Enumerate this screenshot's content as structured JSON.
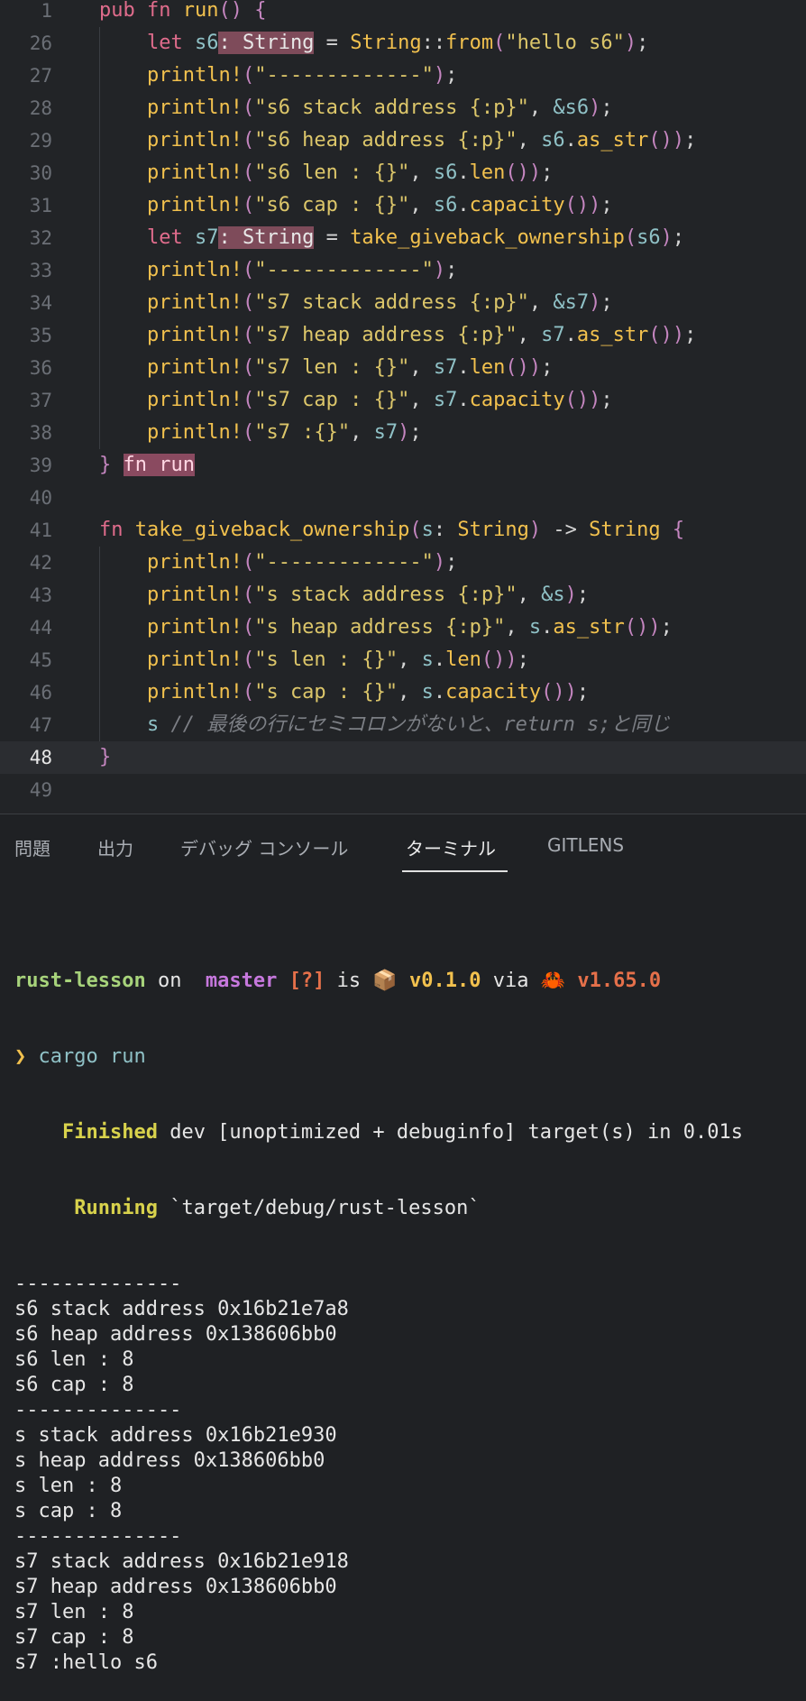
{
  "editor": {
    "lines": [
      {
        "n": "1",
        "tokens": [
          [
            "kw",
            "pub "
          ],
          [
            "kw",
            "fn "
          ],
          [
            "fn",
            "run"
          ],
          [
            "paren",
            "() "
          ],
          [
            "paren",
            "{"
          ]
        ]
      },
      {
        "n": "26",
        "tokens": [
          [
            "sp",
            "    "
          ],
          [
            "kw",
            "let "
          ],
          [
            "var",
            "s6"
          ],
          [
            "hl",
            ": String"
          ],
          [
            "punc",
            " = "
          ],
          [
            "typ",
            "String"
          ],
          [
            "punc",
            "::"
          ],
          [
            "fn",
            "from"
          ],
          [
            "paren",
            "("
          ],
          [
            "str",
            "\"hello s6\""
          ],
          [
            "paren",
            ")"
          ],
          [
            "punc",
            ";"
          ]
        ]
      },
      {
        "n": "27",
        "tokens": [
          [
            "sp",
            "    "
          ],
          [
            "mac",
            "println!"
          ],
          [
            "paren",
            "("
          ],
          [
            "str",
            "\"-------------\""
          ],
          [
            "paren",
            ")"
          ],
          [
            "punc",
            ";"
          ]
        ]
      },
      {
        "n": "28",
        "tokens": [
          [
            "sp",
            "    "
          ],
          [
            "mac",
            "println!"
          ],
          [
            "paren",
            "("
          ],
          [
            "str",
            "\"s6 stack address {:p}\""
          ],
          [
            "punc",
            ", "
          ],
          [
            "var",
            "&s6"
          ],
          [
            "paren",
            ")"
          ],
          [
            "punc",
            ";"
          ]
        ]
      },
      {
        "n": "29",
        "tokens": [
          [
            "sp",
            "    "
          ],
          [
            "mac",
            "println!"
          ],
          [
            "paren",
            "("
          ],
          [
            "str",
            "\"s6 heap address {:p}\""
          ],
          [
            "punc",
            ", "
          ],
          [
            "var",
            "s6"
          ],
          [
            "punc",
            "."
          ],
          [
            "fn",
            "as_str"
          ],
          [
            "paren",
            "())"
          ],
          [
            "punc",
            ";"
          ]
        ]
      },
      {
        "n": "30",
        "tokens": [
          [
            "sp",
            "    "
          ],
          [
            "mac",
            "println!"
          ],
          [
            "paren",
            "("
          ],
          [
            "str",
            "\"s6 len : {}\""
          ],
          [
            "punc",
            ", "
          ],
          [
            "var",
            "s6"
          ],
          [
            "punc",
            "."
          ],
          [
            "fn",
            "len"
          ],
          [
            "paren",
            "())"
          ],
          [
            "punc",
            ";"
          ]
        ]
      },
      {
        "n": "31",
        "tokens": [
          [
            "sp",
            "    "
          ],
          [
            "mac",
            "println!"
          ],
          [
            "paren",
            "("
          ],
          [
            "str",
            "\"s6 cap : {}\""
          ],
          [
            "punc",
            ", "
          ],
          [
            "var",
            "s6"
          ],
          [
            "punc",
            "."
          ],
          [
            "fn",
            "capacity"
          ],
          [
            "paren",
            "())"
          ],
          [
            "punc",
            ";"
          ]
        ]
      },
      {
        "n": "32",
        "tokens": [
          [
            "sp",
            "    "
          ],
          [
            "kw",
            "let "
          ],
          [
            "var",
            "s7"
          ],
          [
            "hl",
            ": String"
          ],
          [
            "punc",
            " = "
          ],
          [
            "fn",
            "take_giveback_ownership"
          ],
          [
            "paren",
            "("
          ],
          [
            "var",
            "s6"
          ],
          [
            "paren",
            ")"
          ],
          [
            "punc",
            ";"
          ]
        ]
      },
      {
        "n": "33",
        "tokens": [
          [
            "sp",
            "    "
          ],
          [
            "mac",
            "println!"
          ],
          [
            "paren",
            "("
          ],
          [
            "str",
            "\"-------------\""
          ],
          [
            "paren",
            ")"
          ],
          [
            "punc",
            ";"
          ]
        ]
      },
      {
        "n": "34",
        "tokens": [
          [
            "sp",
            "    "
          ],
          [
            "mac",
            "println!"
          ],
          [
            "paren",
            "("
          ],
          [
            "str",
            "\"s7 stack address {:p}\""
          ],
          [
            "punc",
            ", "
          ],
          [
            "var",
            "&s7"
          ],
          [
            "paren",
            ")"
          ],
          [
            "punc",
            ";"
          ]
        ]
      },
      {
        "n": "35",
        "tokens": [
          [
            "sp",
            "    "
          ],
          [
            "mac",
            "println!"
          ],
          [
            "paren",
            "("
          ],
          [
            "str",
            "\"s7 heap address {:p}\""
          ],
          [
            "punc",
            ", "
          ],
          [
            "var",
            "s7"
          ],
          [
            "punc",
            "."
          ],
          [
            "fn",
            "as_str"
          ],
          [
            "paren",
            "())"
          ],
          [
            "punc",
            ";"
          ]
        ]
      },
      {
        "n": "36",
        "tokens": [
          [
            "sp",
            "    "
          ],
          [
            "mac",
            "println!"
          ],
          [
            "paren",
            "("
          ],
          [
            "str",
            "\"s7 len : {}\""
          ],
          [
            "punc",
            ", "
          ],
          [
            "var",
            "s7"
          ],
          [
            "punc",
            "."
          ],
          [
            "fn",
            "len"
          ],
          [
            "paren",
            "())"
          ],
          [
            "punc",
            ";"
          ]
        ]
      },
      {
        "n": "37",
        "tokens": [
          [
            "sp",
            "    "
          ],
          [
            "mac",
            "println!"
          ],
          [
            "paren",
            "("
          ],
          [
            "str",
            "\"s7 cap : {}\""
          ],
          [
            "punc",
            ", "
          ],
          [
            "var",
            "s7"
          ],
          [
            "punc",
            "."
          ],
          [
            "fn",
            "capacity"
          ],
          [
            "paren",
            "())"
          ],
          [
            "punc",
            ";"
          ]
        ]
      },
      {
        "n": "38",
        "tokens": [
          [
            "sp",
            "    "
          ],
          [
            "mac",
            "println!"
          ],
          [
            "paren",
            "("
          ],
          [
            "str",
            "\"s7 :{}\""
          ],
          [
            "punc",
            ", "
          ],
          [
            "var",
            "s7"
          ],
          [
            "paren",
            ")"
          ],
          [
            "punc",
            ";"
          ]
        ]
      },
      {
        "n": "39",
        "tokens": [
          [
            "paren",
            "} "
          ],
          [
            "hlrun",
            "fn run"
          ]
        ]
      },
      {
        "n": "40",
        "tokens": []
      },
      {
        "n": "41",
        "tokens": [
          [
            "kw",
            "fn "
          ],
          [
            "fn",
            "take_giveback_ownership"
          ],
          [
            "paren",
            "("
          ],
          [
            "var",
            "s"
          ],
          [
            "punc",
            ": "
          ],
          [
            "typ",
            "String"
          ],
          [
            "paren",
            ")"
          ],
          [
            "punc",
            " -> "
          ],
          [
            "typ",
            "String "
          ],
          [
            "paren",
            "{"
          ]
        ]
      },
      {
        "n": "42",
        "tokens": [
          [
            "sp",
            "    "
          ],
          [
            "mac",
            "println!"
          ],
          [
            "paren",
            "("
          ],
          [
            "str",
            "\"-------------\""
          ],
          [
            "paren",
            ")"
          ],
          [
            "punc",
            ";"
          ]
        ]
      },
      {
        "n": "43",
        "tokens": [
          [
            "sp",
            "    "
          ],
          [
            "mac",
            "println!"
          ],
          [
            "paren",
            "("
          ],
          [
            "str",
            "\"s stack address {:p}\""
          ],
          [
            "punc",
            ", "
          ],
          [
            "var",
            "&s"
          ],
          [
            "paren",
            ")"
          ],
          [
            "punc",
            ";"
          ]
        ]
      },
      {
        "n": "44",
        "tokens": [
          [
            "sp",
            "    "
          ],
          [
            "mac",
            "println!"
          ],
          [
            "paren",
            "("
          ],
          [
            "str",
            "\"s heap address {:p}\""
          ],
          [
            "punc",
            ", "
          ],
          [
            "var",
            "s"
          ],
          [
            "punc",
            "."
          ],
          [
            "fn",
            "as_str"
          ],
          [
            "paren",
            "())"
          ],
          [
            "punc",
            ";"
          ]
        ]
      },
      {
        "n": "45",
        "tokens": [
          [
            "sp",
            "    "
          ],
          [
            "mac",
            "println!"
          ],
          [
            "paren",
            "("
          ],
          [
            "str",
            "\"s len : {}\""
          ],
          [
            "punc",
            ", "
          ],
          [
            "var",
            "s"
          ],
          [
            "punc",
            "."
          ],
          [
            "fn",
            "len"
          ],
          [
            "paren",
            "())"
          ],
          [
            "punc",
            ";"
          ]
        ]
      },
      {
        "n": "46",
        "tokens": [
          [
            "sp",
            "    "
          ],
          [
            "mac",
            "println!"
          ],
          [
            "paren",
            "("
          ],
          [
            "str",
            "\"s cap : {}\""
          ],
          [
            "punc",
            ", "
          ],
          [
            "var",
            "s"
          ],
          [
            "punc",
            "."
          ],
          [
            "fn",
            "capacity"
          ],
          [
            "paren",
            "())"
          ],
          [
            "punc",
            ";"
          ]
        ]
      },
      {
        "n": "47",
        "tokens": [
          [
            "sp",
            "    "
          ],
          [
            "var",
            "s "
          ],
          [
            "cmt",
            "// 最後の行にセミコロンがないと、return s;と同じ"
          ]
        ]
      },
      {
        "n": "48",
        "tokens": [
          [
            "paren",
            "}"
          ]
        ],
        "current": true
      },
      {
        "n": "49",
        "tokens": []
      }
    ]
  },
  "panel": {
    "tabs": [
      {
        "label": "問題"
      },
      {
        "label": "出力"
      },
      {
        "label": "デバッグ コンソール"
      },
      {
        "label": "ターミナル",
        "active": true
      },
      {
        "label": "GITLENS"
      }
    ]
  },
  "terminal": {
    "prompt": {
      "project": "rust-lesson",
      "on": " on ",
      "branch_icon": "",
      "branch": " master",
      "status": " [?]",
      "is": " is ",
      "pkg_icon": "📦",
      "version": " v0.1.0",
      "via": " via ",
      "rust_icon": "🦀",
      "rust_version": " v1.65.0"
    },
    "command_marker": "❯",
    "command": " cargo run",
    "finished_label": "    Finished",
    "finished_text": " dev [unoptimized + debuginfo] target(s) in 0.01s",
    "running_label": "     Running",
    "running_text": " `target/debug/rust-lesson`",
    "output": [
      "--------------",
      "s6 stack address 0x16b21e7a8",
      "s6 heap address 0x138606bb0",
      "s6 len : 8",
      "s6 cap : 8",
      "--------------",
      "s stack address 0x16b21e930",
      "s heap address 0x138606bb0",
      "s len : 8",
      "s cap : 8",
      "--------------",
      "s7 stack address 0x16b21e918",
      "s7 heap address 0x138606bb0",
      "s7 len : 8",
      "s7 cap : 8",
      "s7 :hello s6"
    ]
  }
}
